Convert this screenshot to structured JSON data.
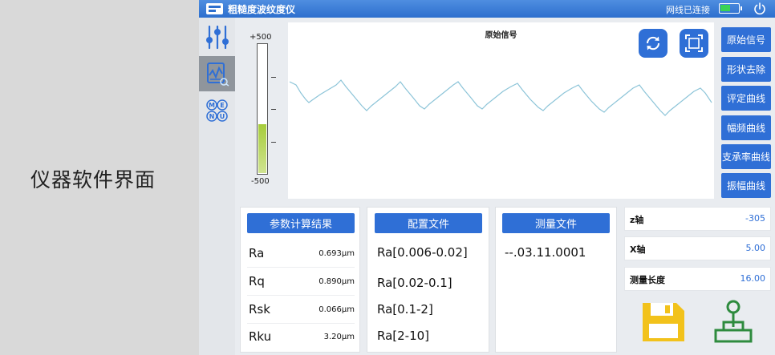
{
  "caption": "仪器软件界面",
  "titlebar": {
    "title": "粗糙度波纹度仪",
    "connection_status": "网线已连接",
    "battery_level": 0.55,
    "icons": [
      "app-logo-icon",
      "battery-icon",
      "power-icon"
    ]
  },
  "sidebar": {
    "items": [
      {
        "name": "sliders-icon"
      },
      {
        "name": "signal-chart-icon",
        "active": true
      },
      {
        "name": "menu-icon",
        "letters": [
          "M",
          "E",
          "N",
          "U"
        ]
      }
    ]
  },
  "gauge": {
    "max_label": "+500",
    "min_label": "-500",
    "range": [
      -500,
      500
    ],
    "value": -120,
    "fill_color": "#a6cc3a"
  },
  "chart": {
    "title": "原始信号",
    "buttons": [
      "refresh-icon",
      "fullscreen-icon"
    ],
    "line_color": "#8cc4d8"
  },
  "right_buttons": [
    "原始信号",
    "形状去除",
    "评定曲线",
    "幅频曲线",
    "支承率曲线",
    "振幅曲线"
  ],
  "params_panel": {
    "header": "参数计算结果",
    "rows": [
      {
        "name": "Ra",
        "value": "0.693μm"
      },
      {
        "name": "Rq",
        "value": "0.890μm"
      },
      {
        "name": "Rsk",
        "value": "0.066μm"
      },
      {
        "name": "Rku",
        "value": "3.20μm"
      }
    ]
  },
  "config_panel": {
    "header": "配置文件",
    "items": [
      "Ra[0.006-0.02]",
      "Ra[0.02-0.1]",
      "Ra[0.1-2]",
      "Ra[2-10]"
    ]
  },
  "measure_panel": {
    "header": "测量文件",
    "items": [
      "--.03.11.0001"
    ]
  },
  "info": {
    "z_axis": {
      "label": "z轴",
      "value": "-305"
    },
    "x_axis": {
      "label": "X轴",
      "value": "5.00"
    },
    "length": {
      "label": "测量长度",
      "value": "16.00"
    }
  },
  "bottom_icons": [
    "save-icon",
    "joystick-icon"
  ],
  "colors": {
    "accent": "#2f6fd6",
    "save": "#f2c21b",
    "joystick": "#2e8b3e"
  }
}
